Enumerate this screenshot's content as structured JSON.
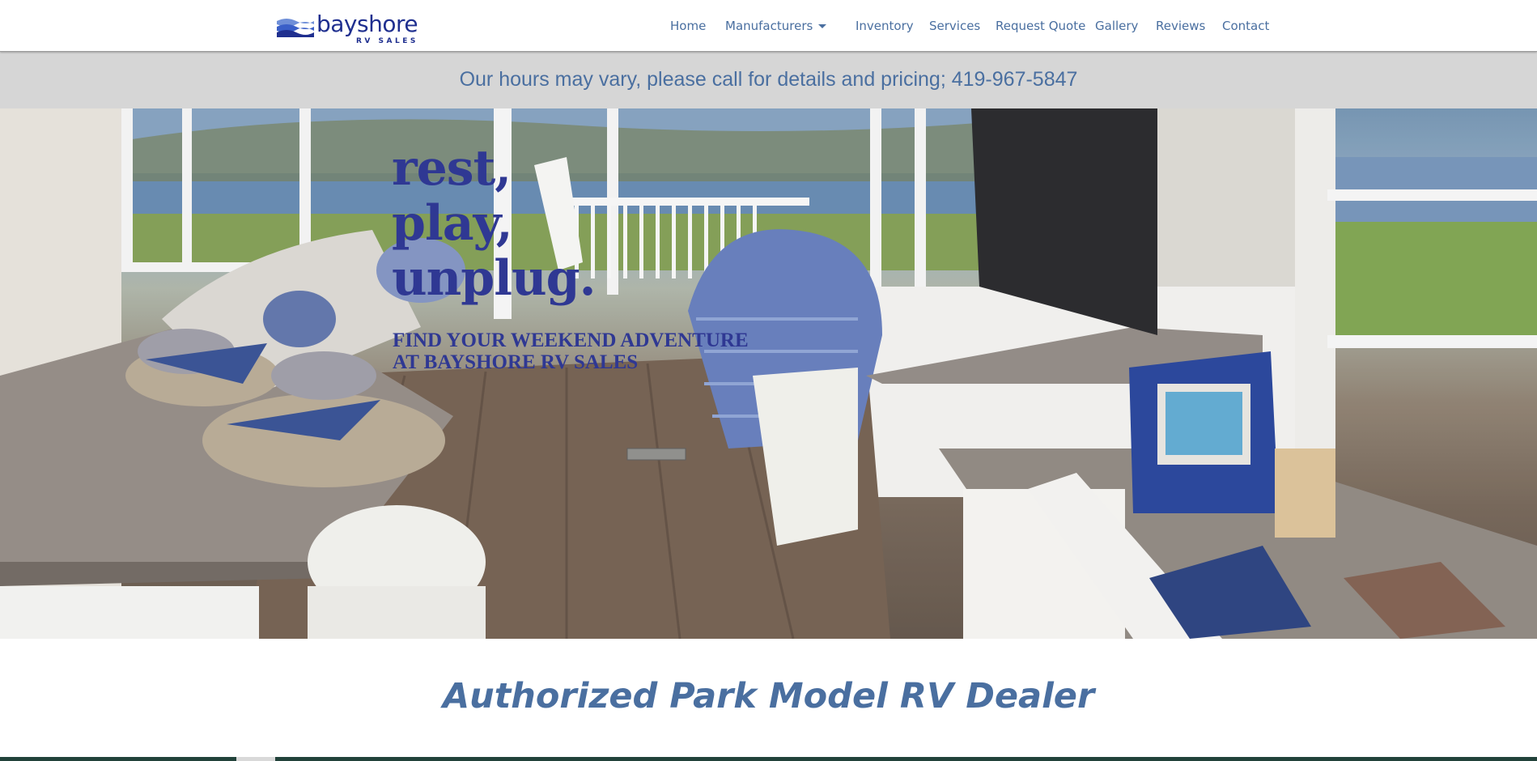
{
  "brand": {
    "name": "bayshore",
    "subname": "RV SALES",
    "color": "#1f2f8f"
  },
  "nav": {
    "items": [
      {
        "label": "Home"
      },
      {
        "label": "Manufacturers",
        "has_dropdown": true
      },
      {
        "label": "Inventory"
      },
      {
        "label": "Services"
      },
      {
        "label": "Request Quote"
      },
      {
        "label": "Gallery"
      },
      {
        "label": "Reviews"
      },
      {
        "label": "Contact"
      }
    ],
    "link_color": "#4a6fa0",
    "dropdown_icon": "caret-down-icon"
  },
  "notice": {
    "text": "Our hours may vary, please call for details and pricing; 419-967-5847",
    "background": "#d6d6d6"
  },
  "hero": {
    "headline": [
      "rest,",
      "play,",
      "unplug."
    ],
    "subline": [
      "FIND YOUR WEEKEND ADVENTURE",
      "AT BAYSHORE RV SALES"
    ],
    "text_color": "#2f3893"
  },
  "section": {
    "heading": "Authorized Park Model RV Dealer"
  }
}
